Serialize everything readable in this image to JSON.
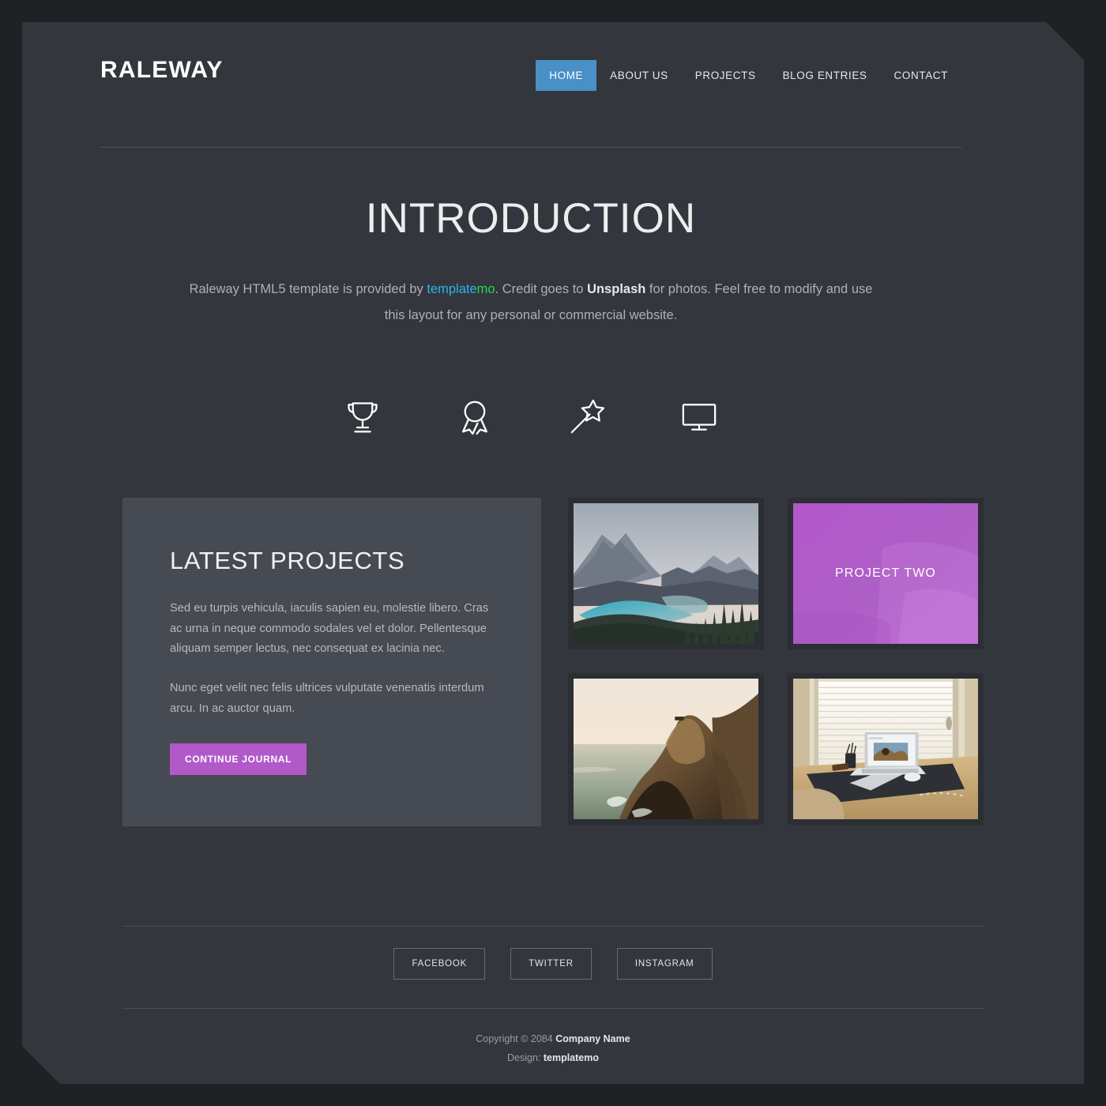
{
  "site": {
    "logo": "RALEWAY"
  },
  "nav": {
    "items": [
      {
        "label": "HOME",
        "active": true
      },
      {
        "label": "ABOUT US",
        "active": false
      },
      {
        "label": "PROJECTS",
        "active": false
      },
      {
        "label": "BLOG ENTRIES",
        "active": false
      },
      {
        "label": "CONTACT",
        "active": false
      }
    ]
  },
  "intro": {
    "title": "INTRODUCTION",
    "text_part1": "Raleway HTML5 template is provided by ",
    "link_a": "template",
    "link_b": "mo",
    "text_part2": ". Credit goes to ",
    "credit": "Unsplash",
    "text_part3": " for photos. Feel free to modify and use this layout for any personal or commercial website."
  },
  "features": {
    "icons": [
      {
        "name": "trophy-icon"
      },
      {
        "name": "award-ribbon-icon"
      },
      {
        "name": "magic-wand-icon"
      },
      {
        "name": "monitor-icon"
      }
    ]
  },
  "projects": {
    "title": "LATEST PROJECTS",
    "paragraph1": "Sed eu turpis vehicula, iaculis sapien eu, molestie libero. Cras ac urna in neque commodo sodales vel et dolor. Pellentesque aliquam semper lectus, nec consequat ex lacinia nec.",
    "paragraph2": "Nunc eget velit nec felis ultrices vulputate venenatis interdum arcu. In ac auctor quam.",
    "button_label": "CONTINUE JOURNAL",
    "thumbnails": [
      {
        "name": "thumb-mountain-lake",
        "label": "",
        "kind": "photo-mountain-lake"
      },
      {
        "name": "thumb-project-two",
        "label": "PROJECT TWO",
        "kind": "overlay-purple"
      },
      {
        "name": "thumb-coastal-cliff",
        "label": "",
        "kind": "photo-coastal-cliff"
      },
      {
        "name": "thumb-desk-laptop",
        "label": "",
        "kind": "photo-desk-laptop"
      }
    ]
  },
  "footer": {
    "social": [
      {
        "label": "FACEBOOK"
      },
      {
        "label": "TWITTER"
      },
      {
        "label": "INSTAGRAM"
      }
    ],
    "copyright_prefix": "Copyright © 2084 ",
    "company": "Company Name",
    "design_prefix": "Design: ",
    "designer": "templatemo"
  },
  "colors": {
    "page_background": "#33373d",
    "outer_background": "#1f2124",
    "panel_background": "#464a53",
    "accent_blue": "#4a8fc6",
    "accent_purple": "#b259c9",
    "link_cyan": "#2fb5e8",
    "link_green": "#22d84a"
  }
}
